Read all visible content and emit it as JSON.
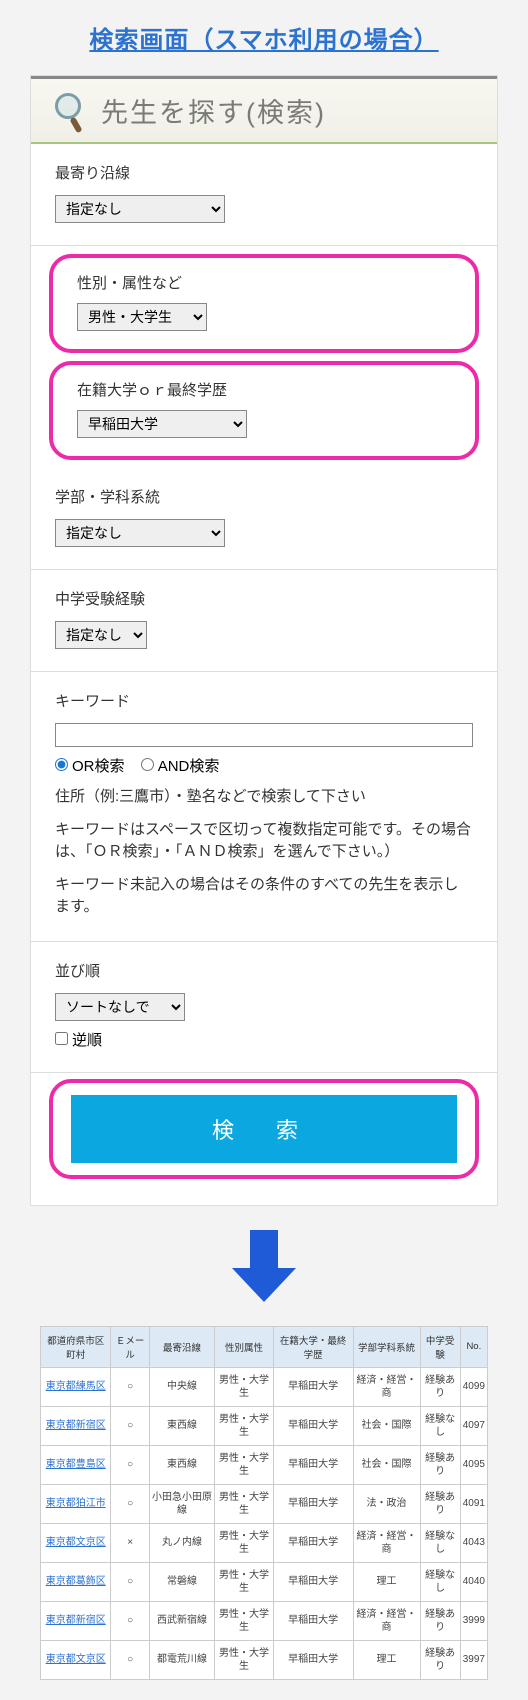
{
  "page_title": "検索画面（スマホ利用の場合）",
  "search_header": "先生を探す(検索)",
  "sections": {
    "nearest_line": {
      "label": "最寄り沿線",
      "value": "指定なし"
    },
    "gender_attr": {
      "label": "性別・属性など",
      "value": "男性・大学生"
    },
    "university": {
      "label": "在籍大学ｏｒ最終学歴",
      "value": "早稲田大学"
    },
    "faculty": {
      "label": "学部・学科系統",
      "value": "指定なし"
    },
    "jhs_exam": {
      "label": "中学受験経験",
      "value": "指定なし"
    },
    "keyword": {
      "label": "キーワード",
      "value": "",
      "or_label": "OR検索",
      "and_label": "AND検索",
      "help1": "住所（例:三鷹市）・塾名などで検索して下さい",
      "help2": "キーワードはスペースで区切って複数指定可能です。その場合は、「ＯＲ検索」・「ＡＮＤ検索」を選んで下さい。）",
      "help3": "キーワード未記入の場合はその条件のすべての先生を表示します。"
    },
    "sort": {
      "label": "並び順",
      "value": "ソートなしで",
      "reverse_label": "逆順"
    }
  },
  "submit_label": "検 索",
  "table": {
    "headers": [
      "都道府県市区町村",
      "Ｅメール",
      "最寄沿線",
      "性別属性",
      "在籍大学・最終学歴",
      "学部学科系統",
      "中学受験",
      "No."
    ],
    "rows": [
      {
        "city": "東京都練馬区",
        "email": "○",
        "line": "中央線",
        "attr": "男性・大学生",
        "univ": "早稲田大学",
        "faculty": "経済・経営・商",
        "exam": "経験あり",
        "no": "4099"
      },
      {
        "city": "東京都新宿区",
        "email": "○",
        "line": "東西線",
        "attr": "男性・大学生",
        "univ": "早稲田大学",
        "faculty": "社会・国際",
        "exam": "経験なし",
        "no": "4097"
      },
      {
        "city": "東京都豊島区",
        "email": "○",
        "line": "東西線",
        "attr": "男性・大学生",
        "univ": "早稲田大学",
        "faculty": "社会・国際",
        "exam": "経験あり",
        "no": "4095"
      },
      {
        "city": "東京都狛江市",
        "email": "○",
        "line": "小田急小田原線",
        "attr": "男性・大学生",
        "univ": "早稲田大学",
        "faculty": "法・政治",
        "exam": "経験あり",
        "no": "4091"
      },
      {
        "city": "東京都文京区",
        "email": "×",
        "line": "丸ノ内線",
        "attr": "男性・大学生",
        "univ": "早稲田大学",
        "faculty": "経済・経営・商",
        "exam": "経験なし",
        "no": "4043"
      },
      {
        "city": "東京都葛飾区",
        "email": "○",
        "line": "常磐線",
        "attr": "男性・大学生",
        "univ": "早稲田大学",
        "faculty": "理工",
        "exam": "経験なし",
        "no": "4040"
      },
      {
        "city": "東京都新宿区",
        "email": "○",
        "line": "西武新宿線",
        "attr": "男性・大学生",
        "univ": "早稲田大学",
        "faculty": "経済・経営・商",
        "exam": "経験あり",
        "no": "3999"
      },
      {
        "city": "東京都文京区",
        "email": "○",
        "line": "都電荒川線",
        "attr": "男性・大学生",
        "univ": "早稲田大学",
        "faculty": "理工",
        "exam": "経験あり",
        "no": "3997"
      }
    ]
  }
}
